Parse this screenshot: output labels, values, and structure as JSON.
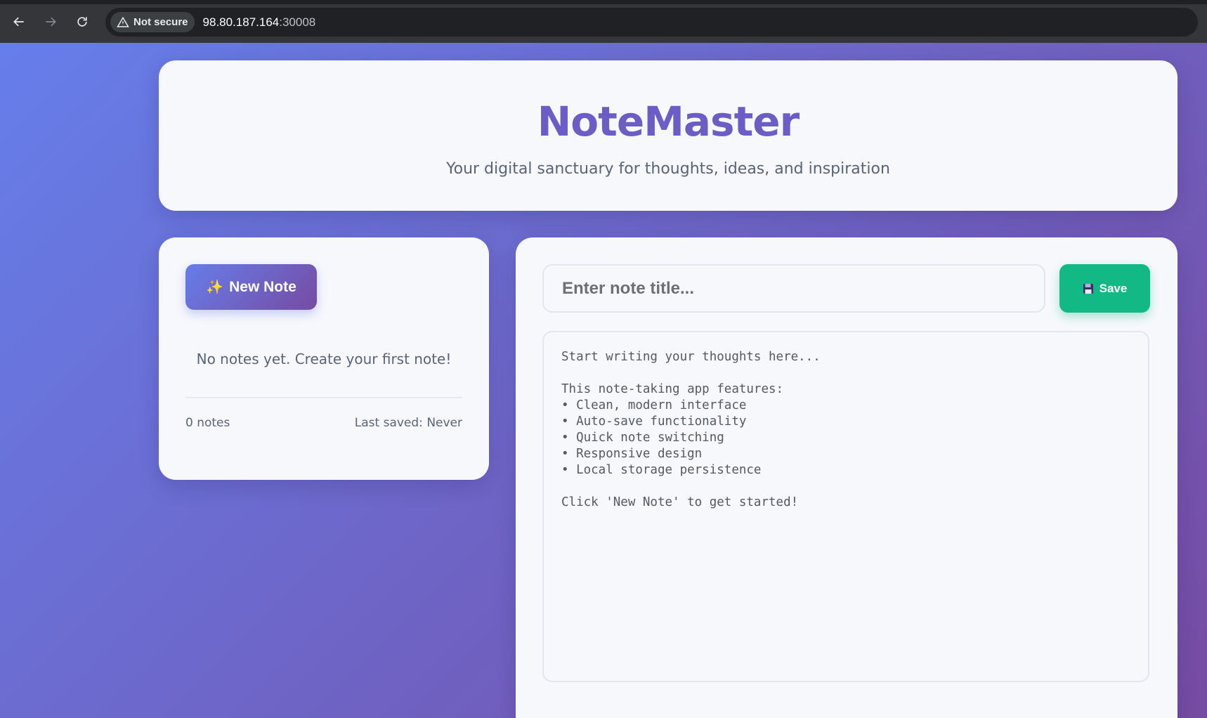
{
  "browser": {
    "security_label": "Not secure",
    "url_host": "98.80.187.164",
    "url_port": ":30008"
  },
  "header": {
    "title": "NoteMaster",
    "subtitle": "Your digital sanctuary for thoughts, ideas, and inspiration"
  },
  "sidebar": {
    "new_note_label": "New Note",
    "new_note_icon": "sparkles-icon",
    "empty_message": "No notes yet. Create your first note!",
    "note_count": "0 notes",
    "last_saved": "Last saved: Never"
  },
  "editor": {
    "title_placeholder": "Enter note title...",
    "save_label": "Save",
    "save_icon": "floppy-disk-icon",
    "content_placeholder": "Start writing your thoughts here...\n\nThis note-taking app features:\n• Clean, modern interface\n• Auto-save functionality\n• Quick note switching\n• Responsive design\n• Local storage persistence\n\nClick 'New Note' to get started!"
  },
  "colors": {
    "gradient_start": "#667eea",
    "gradient_end": "#764ba2",
    "title_color": "#6b5cc6",
    "save_button": "#13b985"
  }
}
